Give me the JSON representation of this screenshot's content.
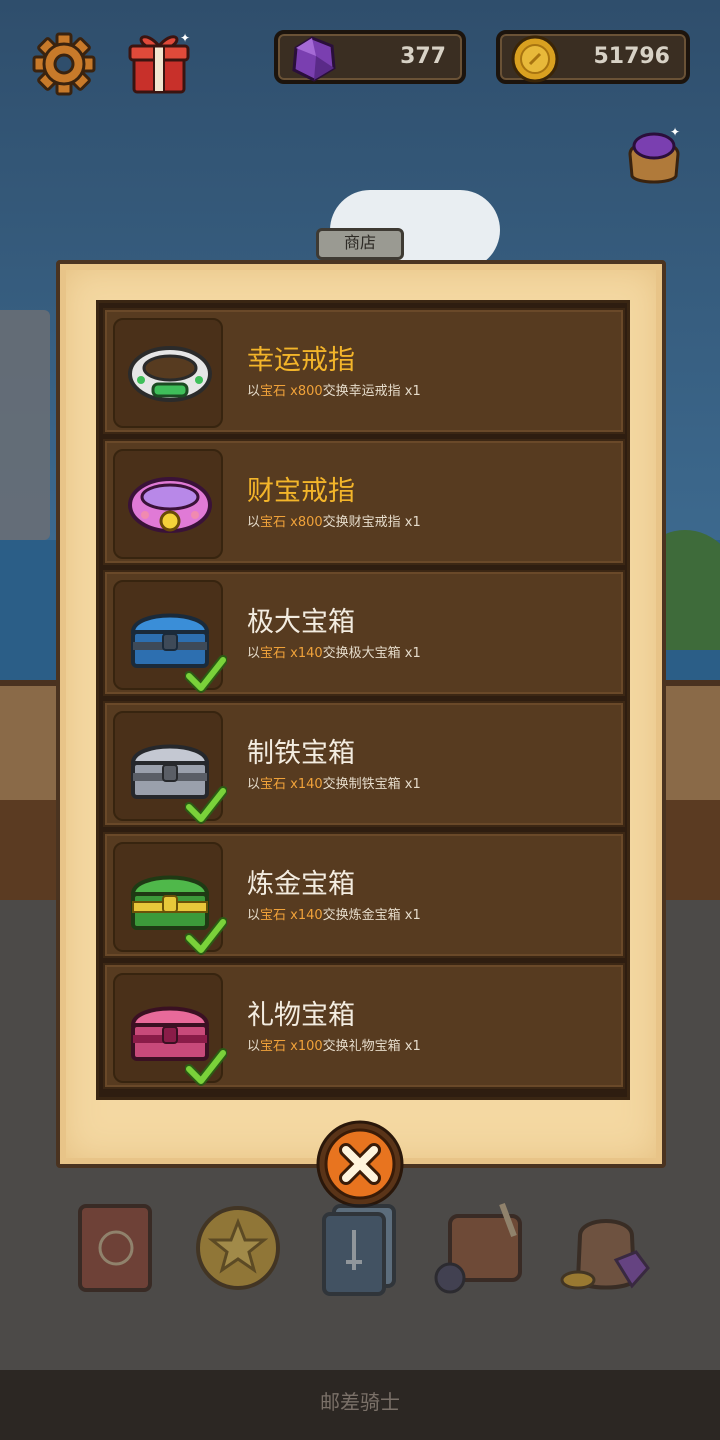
{
  "hud": {
    "gems": "377",
    "coins": "51796",
    "settings_icon": "gear-icon",
    "gift_icon": "gift-box-icon",
    "gem_bag_icon": "gem-bag-icon"
  },
  "shop": {
    "tab_label": "商店",
    "items": [
      {
        "title": "幸运戒指",
        "desc_prefix": "以",
        "currency": "宝石",
        "cost": " x800",
        "desc_suffix": "交换幸运戒指 x1",
        "owned": false,
        "icon": "green-ring-icon"
      },
      {
        "title": "财宝戒指",
        "desc_prefix": "以",
        "currency": "宝石",
        "cost": " x800",
        "desc_suffix": "交换财宝戒指 x1",
        "owned": false,
        "icon": "pink-ring-icon"
      },
      {
        "title": "极大宝箱",
        "desc_prefix": "以",
        "currency": "宝石",
        "cost": " x140",
        "desc_suffix": "交换极大宝箱 x1",
        "owned": true,
        "icon": "blue-chest-icon"
      },
      {
        "title": "制铁宝箱",
        "desc_prefix": "以",
        "currency": "宝石",
        "cost": " x140",
        "desc_suffix": "交换制铁宝箱 x1",
        "owned": true,
        "icon": "iron-chest-icon"
      },
      {
        "title": "炼金宝箱",
        "desc_prefix": "以",
        "currency": "宝石",
        "cost": " x140",
        "desc_suffix": "交换炼金宝箱 x1",
        "owned": true,
        "icon": "alchemy-chest-icon"
      },
      {
        "title": "礼物宝箱",
        "desc_prefix": "以",
        "currency": "宝石",
        "cost": " x100",
        "desc_suffix": "交换礼物宝箱 x1",
        "owned": true,
        "icon": "gift-chest-icon"
      }
    ],
    "close_icon": "close-icon"
  },
  "bottom_nav": [
    "book-icon",
    "star-coin-icon",
    "card-deck-icon",
    "backpack-icon",
    "treasure-bag-icon"
  ],
  "footer": {
    "game_title": "邮差骑士"
  },
  "colors": {
    "gold_title": "#f3b52a",
    "highlight": "#f0a23a",
    "panel_bg": "#f4d8a2",
    "row_bg": "#573b20"
  }
}
